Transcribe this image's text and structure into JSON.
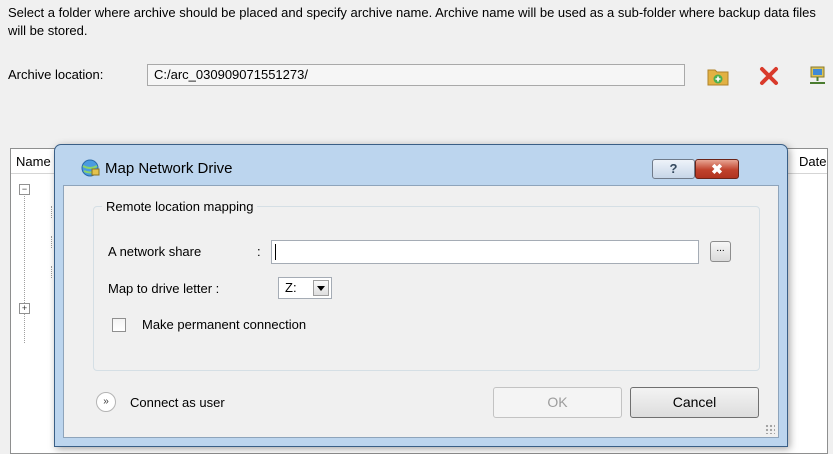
{
  "description": "Select a folder where archive should be placed and specify archive name. Archive name will be used as a sub-folder where backup data files will be stored.",
  "archive_location": {
    "label": "Archive location:",
    "value": "C:/arc_030909071551273/"
  },
  "toolbar": {
    "icons": [
      "add-folder-icon",
      "delete-icon",
      "map-network-drive-icon"
    ],
    "colors": {
      "folder": "#e2b143",
      "delete": "#d93a2b"
    }
  },
  "list": {
    "col_name": "Name",
    "col_date": "Date"
  },
  "dialog": {
    "title": "Map Network Drive",
    "help_glyph": "?",
    "close_glyph": "✖",
    "group_title": "Remote location mapping",
    "network_share_label": "A network share",
    "network_share_colon": ":",
    "network_share_value": "",
    "browse_label": "...",
    "drive_label": "Map to drive letter :",
    "drive_value": "Z:",
    "permanent_label": "Make permanent connection",
    "permanent_checked": false,
    "connect_as_user": "Connect as user",
    "expand_glyph": "»",
    "ok": "OK",
    "cancel": "Cancel",
    "colors": {
      "frame": "#bcd5ee",
      "close": "#c0422c"
    }
  }
}
